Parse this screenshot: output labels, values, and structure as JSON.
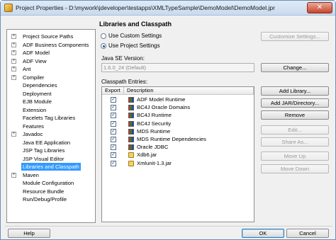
{
  "window": {
    "title": "Project Properties - D:\\mywork\\jdeveloper\\testapps\\XMLTypeSample\\DemoModel\\DemoModel.jpr",
    "close_glyph": "✕"
  },
  "tree": {
    "items": [
      {
        "label": "Project Source Paths",
        "expander": "+"
      },
      {
        "label": "ADF Business Components",
        "expander": "+"
      },
      {
        "label": "ADF Model",
        "expander": "+"
      },
      {
        "label": "ADF View",
        "expander": "+"
      },
      {
        "label": "Ant",
        "expander": "+"
      },
      {
        "label": "Compiler",
        "expander": "+"
      },
      {
        "label": "Dependencies",
        "expander": ""
      },
      {
        "label": "Deployment",
        "expander": ""
      },
      {
        "label": "EJB Module",
        "expander": ""
      },
      {
        "label": "Extension",
        "expander": ""
      },
      {
        "label": "Facelets Tag Libraries",
        "expander": ""
      },
      {
        "label": "Features",
        "expander": ""
      },
      {
        "label": "Javadoc",
        "expander": "+"
      },
      {
        "label": "Java EE Application",
        "expander": ""
      },
      {
        "label": "JSP Tag Libraries",
        "expander": ""
      },
      {
        "label": "JSP Visual Editor",
        "expander": ""
      },
      {
        "label": "Libraries and Classpath",
        "expander": ""
      },
      {
        "label": "Maven",
        "expander": "+"
      },
      {
        "label": "Module Configuration",
        "expander": ""
      },
      {
        "label": "Resource Bundle",
        "expander": ""
      },
      {
        "label": "Run/Debug/Profile",
        "expander": ""
      }
    ],
    "selected_index": 16
  },
  "main": {
    "heading": "Libraries and Classpath",
    "radio_custom": "Use Custom Settings",
    "radio_project": "Use Project Settings",
    "customize_button": "Customize Settings...",
    "java_se_label": "Java SE Version:",
    "java_se_value": "1.6.0_24 (Default)",
    "change_button": "Change...",
    "classpath_label": "Classpath Entries:",
    "col_export": "Export",
    "col_description": "Description",
    "entries": [
      {
        "label": "ADF Model Runtime",
        "checked": true,
        "icon": "library-icon"
      },
      {
        "label": "BC4J Oracle Domains",
        "checked": true,
        "icon": "library-icon"
      },
      {
        "label": "BC4J Runtime",
        "checked": true,
        "icon": "library-icon"
      },
      {
        "label": "BC4J Security",
        "checked": true,
        "icon": "library-icon"
      },
      {
        "label": "MDS Runtime",
        "checked": true,
        "icon": "library-icon"
      },
      {
        "label": "MDS Runtime Dependencies",
        "checked": true,
        "icon": "library-icon"
      },
      {
        "label": "Oracle JDBC",
        "checked": true,
        "icon": "library-icon"
      },
      {
        "label": "Xdb6.jar",
        "checked": true,
        "icon": "jar-icon"
      },
      {
        "label": "Xmlunit-1.3.jar",
        "checked": true,
        "icon": "jar-icon"
      }
    ],
    "check_glyph": "✓",
    "buttons": {
      "add_library": "Add Library...",
      "add_jar": "Add JAR/Directory...",
      "remove": "Remove",
      "edit": "Edit...",
      "share_as": "Share As...",
      "move_up": "Move Up",
      "move_down": "Move Down"
    }
  },
  "footer": {
    "help": "Help",
    "ok": "OK",
    "cancel": "Cancel"
  }
}
